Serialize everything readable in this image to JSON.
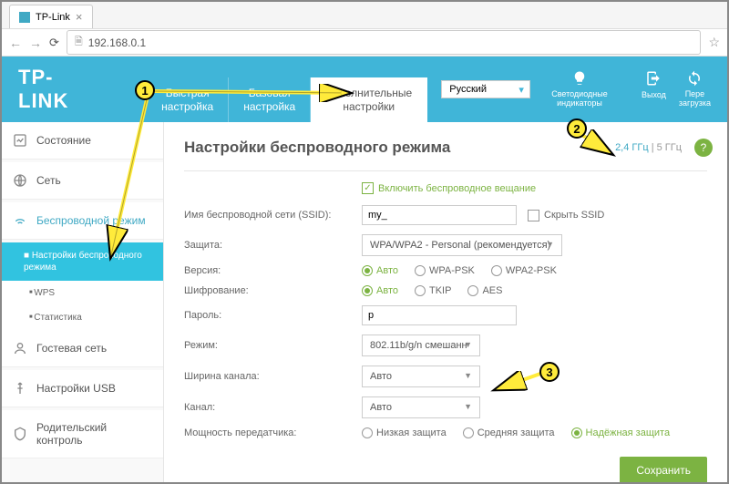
{
  "browser": {
    "tab_title": "TP-Link",
    "url": "192.168.0.1"
  },
  "header": {
    "logo": "TP-LINK",
    "nav": {
      "quick": "Быстрая\nнастройка",
      "basic": "Базовая\nнастройка",
      "advanced": "Дополнительные\nнастройки"
    },
    "language": "Русский",
    "icons": {
      "led": "Светодиодные индикаторы",
      "logout": "Выход",
      "reboot": "Пере\nзагрузка"
    }
  },
  "sidebar": {
    "status": "Состояние",
    "network": "Сеть",
    "wireless": "Беспроводной режим",
    "wireless_sub": {
      "settings": "Настройки беспроводного режима",
      "wps": "WPS",
      "stats": "Статистика"
    },
    "guest": "Гостевая сеть",
    "usb": "Настройки USB",
    "parental": "Родительский контроль"
  },
  "main": {
    "title": "Настройки беспроводного режима",
    "freq": {
      "ghz24": "2,4 ГГц",
      "ghz5": "5 ГГц"
    },
    "enable": "Включить беспроводное вещание",
    "labels": {
      "ssid": "Имя беспроводной сети (SSID):",
      "security": "Защита:",
      "version": "Версия:",
      "encryption": "Шифрование:",
      "password": "Пароль:",
      "mode": "Режим:",
      "width": "Ширина канала:",
      "channel": "Канал:",
      "txpower": "Мощность передатчика:"
    },
    "values": {
      "ssid": "my_",
      "hide_ssid": "Скрыть SSID",
      "security": "WPA/WPA2 - Personal (рекомендуется)",
      "password": "p",
      "mode": "802.11b/g/n смешанн",
      "width": "Авто",
      "channel": "Авто"
    },
    "radios": {
      "auto": "Авто",
      "wpa_psk": "WPA-PSK",
      "wpa2_psk": "WPA2-PSK",
      "tkip": "TKIP",
      "aes": "AES",
      "low": "Низкая защита",
      "medium": "Средняя защита",
      "high": "Надёжная защита"
    },
    "save": "Сохранить"
  },
  "annotations": {
    "1": "1",
    "2": "2",
    "3": "3"
  }
}
